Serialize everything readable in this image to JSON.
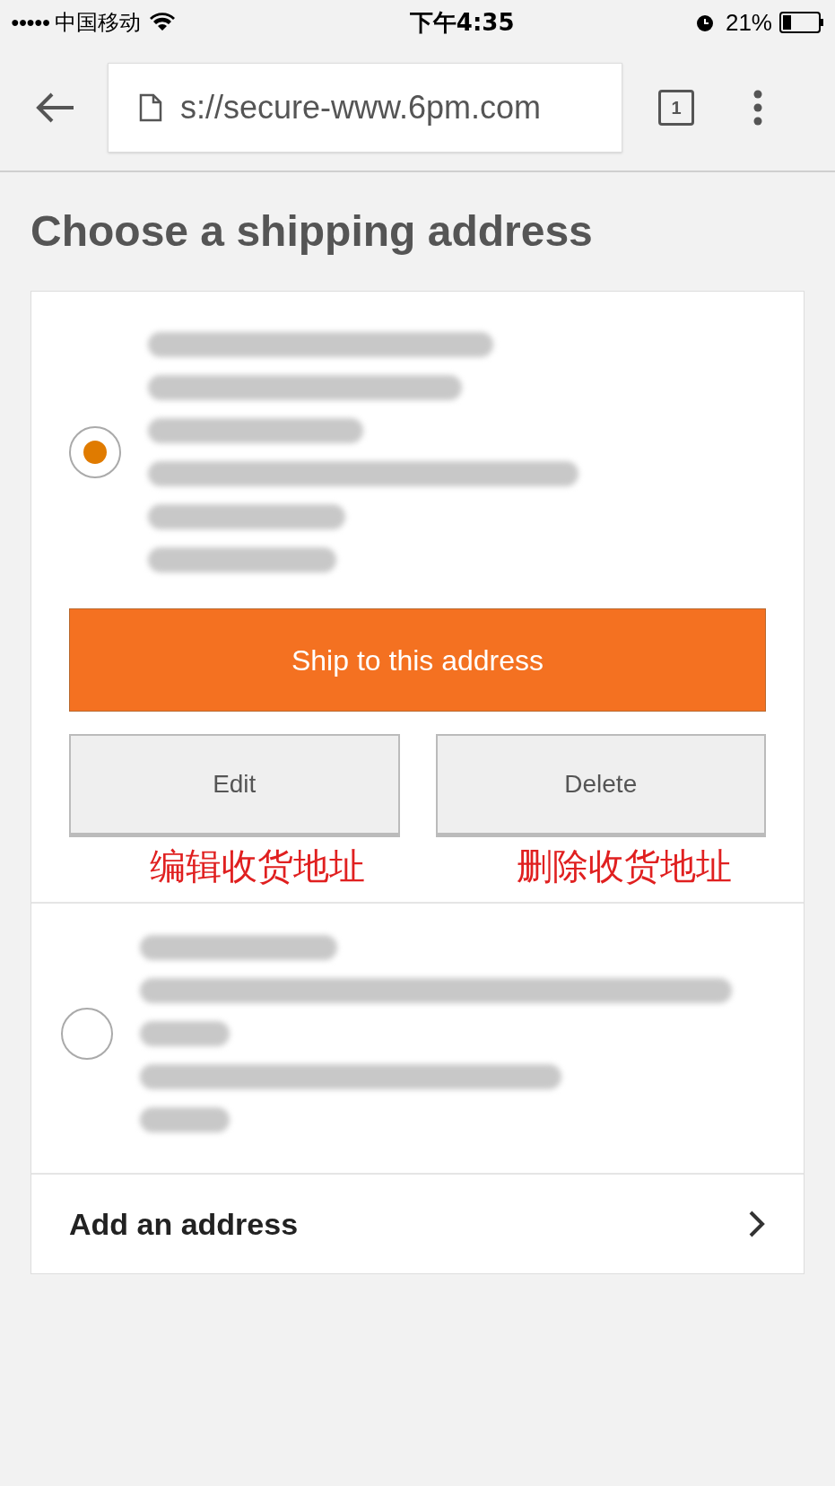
{
  "status_bar": {
    "signal": "●●●●●",
    "carrier": "中国移动",
    "time": "下午4:35",
    "battery": "21%"
  },
  "browser": {
    "url": "s://secure-www.6pm.com",
    "tab_count": "1"
  },
  "title": "Choose a shipping address",
  "addresses": [
    {
      "selected": true,
      "ship_button": "Ship to this address",
      "actions": [
        "Edit",
        "Delete"
      ],
      "annotations": [
        "编辑收货地址",
        "删除收货地址"
      ]
    },
    {
      "selected": false
    }
  ],
  "add_address": "Add an address"
}
